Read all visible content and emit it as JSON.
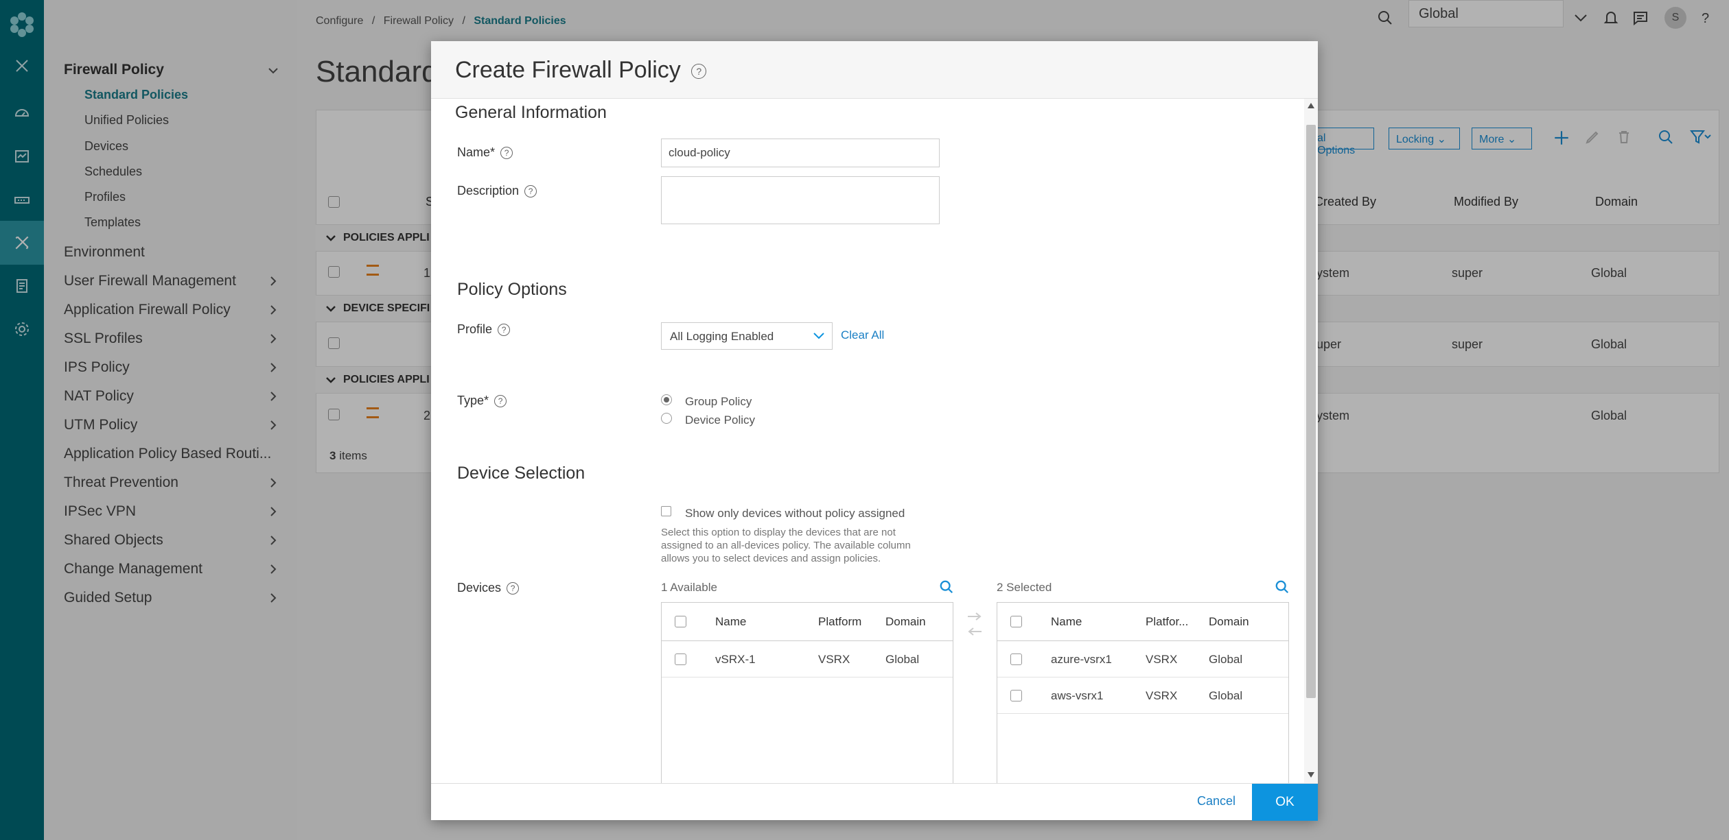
{
  "breadcrumb": {
    "items": [
      "Configure",
      "Firewall Policy"
    ],
    "separator": "/",
    "current": "Standard Policies"
  },
  "page": {
    "title": "Standard"
  },
  "header": {
    "domain_select": "Global",
    "avatar_initial": "S"
  },
  "sidebar": {
    "section_title": "Firewall Policy",
    "sub_items": [
      "Standard Policies",
      "Unified Policies",
      "Devices",
      "Schedules",
      "Profiles",
      "Templates"
    ],
    "items": [
      {
        "label": "Environment",
        "chevron": false
      },
      {
        "label": "User Firewall Management",
        "chevron": true
      },
      {
        "label": "Application Firewall Policy",
        "chevron": true
      },
      {
        "label": "SSL Profiles",
        "chevron": true
      },
      {
        "label": "IPS Policy",
        "chevron": true
      },
      {
        "label": "NAT Policy",
        "chevron": true
      },
      {
        "label": "UTM Policy",
        "chevron": true
      },
      {
        "label": "Application Policy Based Routi...",
        "chevron": false
      },
      {
        "label": "Threat Prevention",
        "chevron": true
      },
      {
        "label": "IPSec VPN",
        "chevron": true
      },
      {
        "label": "Shared Objects",
        "chevron": true
      },
      {
        "label": "Change Management",
        "chevron": true
      },
      {
        "label": "Guided Setup",
        "chevron": true
      }
    ]
  },
  "grid": {
    "toolbar": {
      "options_label": "al Options",
      "locking_label": "Locking",
      "more_label": "More"
    },
    "columns": {
      "s": "S",
      "created_by": "Created By",
      "modified_by": "Modified By",
      "domain": "Domain"
    },
    "groups": [
      "POLICIES APPLI",
      "DEVICE SPECIFI",
      "POLICIES APPLI"
    ],
    "rows": [
      {
        "seq": "1",
        "created_by": "ystem",
        "modified_by": "super",
        "domain": "Global"
      },
      {
        "seq": "",
        "created_by": "uper",
        "modified_by": "super",
        "domain": "Global"
      },
      {
        "seq": "2",
        "created_by": "ystem",
        "modified_by": "",
        "domain": "Global"
      }
    ],
    "footer_count": "3",
    "footer_label": "items"
  },
  "modal": {
    "title": "Create Firewall Policy",
    "general": {
      "title": "General Information",
      "name_label": "Name*",
      "name_value": "cloud-policy",
      "description_label": "Description",
      "description_value": ""
    },
    "policy_options": {
      "title": "Policy Options",
      "profile_label": "Profile",
      "profile_value": "All Logging Enabled",
      "clear_all": "Clear All",
      "type_label": "Type*",
      "type_options": [
        "Group Policy",
        "Device Policy"
      ],
      "type_selected": "Group Policy"
    },
    "device_selection": {
      "title": "Device Selection",
      "show_only_label": "Show only devices without policy assigned",
      "hint": "Select this option to display the devices that are not assigned to an all-devices policy. The available column allows you to select devices and assign policies.",
      "devices_label": "Devices",
      "available": {
        "count_label": "1 Available",
        "columns": [
          "Name",
          "Platform",
          "Domain"
        ],
        "rows": [
          {
            "name": "vSRX-1",
            "platform": "VSRX",
            "domain": "Global"
          }
        ]
      },
      "selected": {
        "count_label": "2 Selected",
        "columns": [
          "Name",
          "Platfor...",
          "Domain"
        ],
        "rows": [
          {
            "name": "azure-vsrx1",
            "platform": "VSRX",
            "domain": "Global"
          },
          {
            "name": "aws-vsrx1",
            "platform": "VSRX",
            "domain": "Global"
          }
        ]
      }
    },
    "footer": {
      "cancel": "Cancel",
      "ok": "OK"
    }
  },
  "colors": {
    "rail": "#006b78",
    "accent": "#1a7d8c",
    "primary_button": "#0d94df",
    "link": "#1a7fc4"
  }
}
